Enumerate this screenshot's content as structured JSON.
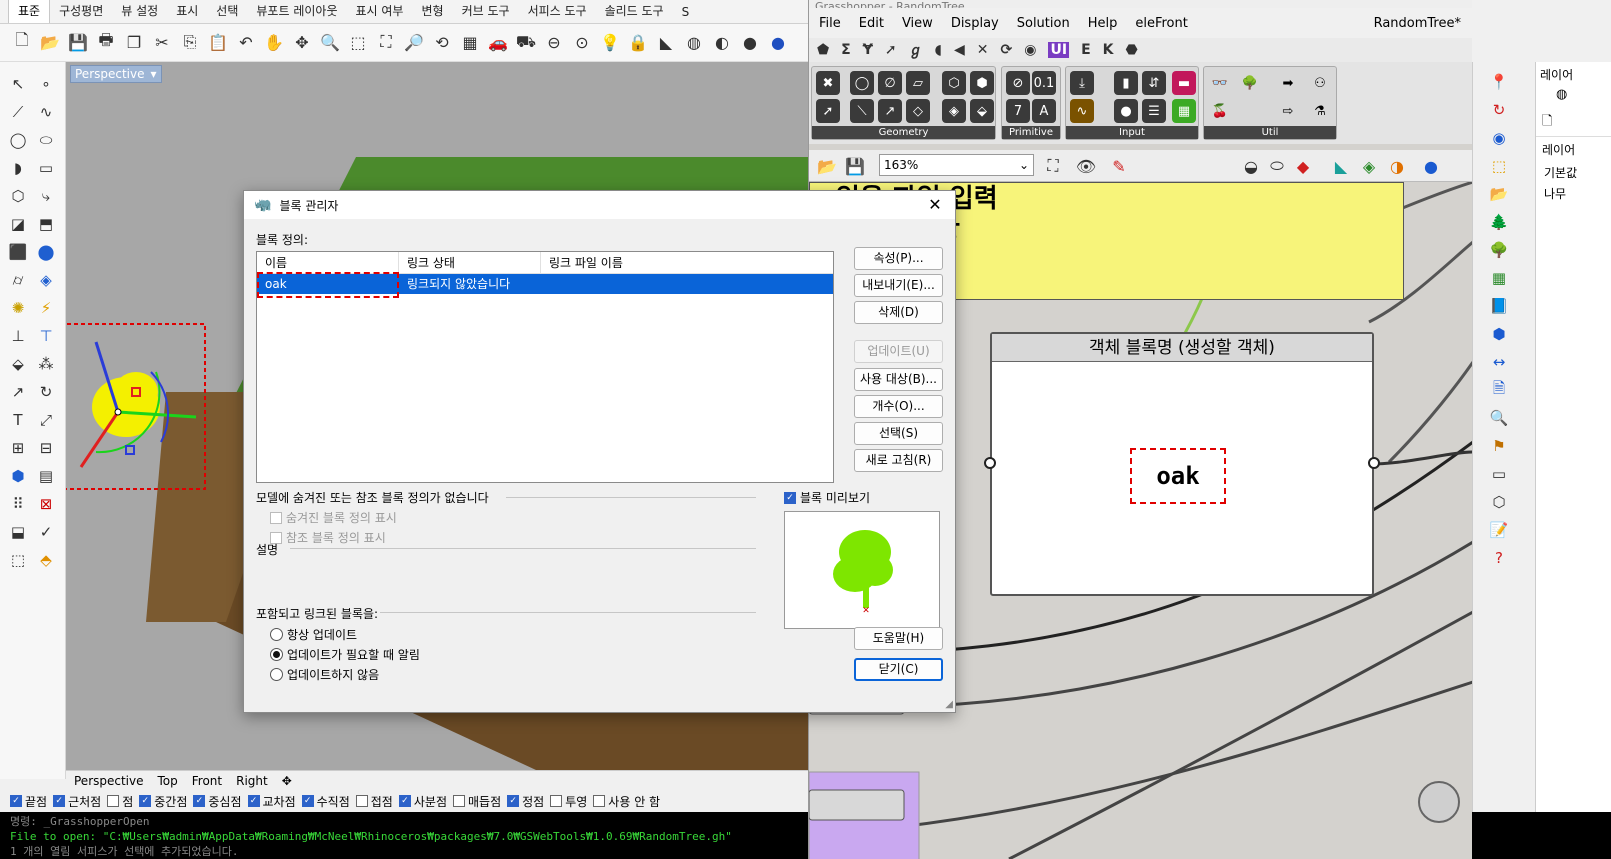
{
  "rhino": {
    "tabs": [
      "표준",
      "구성평면",
      "뷰 설정",
      "표시",
      "선택",
      "뷰포트 레이아웃",
      "표시 여부",
      "변형",
      "커브 도구",
      "서피스 도구",
      "솔리드 도구",
      "S"
    ],
    "viewport_label": "Perspective",
    "viewport_tabs": [
      "Perspective",
      "Top",
      "Front",
      "Right"
    ],
    "snaps": [
      {
        "label": "끝점",
        "on": true
      },
      {
        "label": "근처점",
        "on": true
      },
      {
        "label": "점",
        "on": false
      },
      {
        "label": "중간점",
        "on": true
      },
      {
        "label": "중심점",
        "on": true
      },
      {
        "label": "교차점",
        "on": true
      },
      {
        "label": "수직점",
        "on": true
      },
      {
        "label": "접점",
        "on": false
      },
      {
        "label": "사분점",
        "on": true
      },
      {
        "label": "매듭점",
        "on": false
      },
      {
        "label": "정점",
        "on": true
      },
      {
        "label": "투영",
        "on": false
      },
      {
        "label": "사용 안 함",
        "on": false
      }
    ],
    "command_lines": [
      "명령: _GrasshopperOpen",
      "File to open: \"C:₩Users₩admin₩AppData₩Roaming₩McNeel₩Rhinoceros₩packages₩7.0₩GSWebTools₩1.0.69₩RandomTree.gh\"",
      "1 개의 열림 서피스가 선택에 추가되었습니다."
    ]
  },
  "grasshopper": {
    "title": "Grasshopper - RandomTree",
    "menu": [
      "File",
      "Edit",
      "View",
      "Display",
      "Solution",
      "Help",
      "eleFront"
    ],
    "doc_name": "RandomTree*",
    "groups": [
      "Geometry",
      "Primitive",
      "Input",
      "Util"
    ],
    "zoom": "163%",
    "sticky_text": [
      "읽을 파일 입력",
      "상"
    ],
    "panel_title": "객체 블록명 (생성할 객체)",
    "panel_value": "oak"
  },
  "right_panel": {
    "header": "레이어",
    "items": [
      "레이어",
      "기본값",
      "나무"
    ]
  },
  "dialog": {
    "title": "블록 관리자",
    "section_label": "블록 정의:",
    "columns": [
      "이름",
      "링크 상태",
      "링크 파일 이름"
    ],
    "rows": [
      {
        "name": "oak",
        "status": "링크되지 않았습니다",
        "file": ""
      }
    ],
    "buttons": {
      "props": "속성(P)...",
      "export": "내보내기(E)...",
      "delete": "삭제(D)",
      "update": "업데이트(U)",
      "used": "사용 대상(B)...",
      "count": "개수(O)...",
      "select": "선택(S)",
      "refresh": "새로 고침(R)",
      "help": "도움말(H)",
      "close": "닫기(C)"
    },
    "hidden_note": "모델에 숨겨진 또는 참조 블록 정의가 없습니다",
    "show_hidden": "숨겨진 블록 정의 표시",
    "show_ref": "참조 블록 정의 표시",
    "preview_label": "블록 미리보기",
    "desc_label": "설명",
    "linked_label": "포함되고 링크된 블록을:",
    "options": [
      "항상 업데이트",
      "업데이트가 필요할 때 알림",
      "업데이트하지 않음"
    ],
    "selected_option": 1
  },
  "colors": {
    "accent": "#0a64d8",
    "highlight": "#e00000",
    "sticky": "#f7f47a",
    "tree": "#7ee600"
  }
}
